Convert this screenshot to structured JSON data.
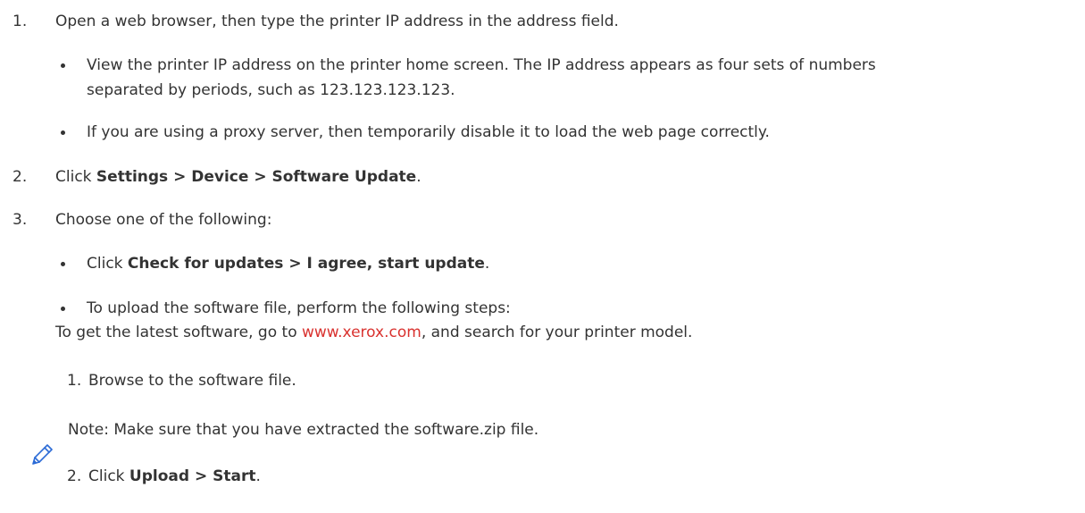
{
  "steps": [
    {
      "number": "1.",
      "text": "Open a web browser, then type the printer IP address in the address field.",
      "bullets": [
        {
          "line1": "View the printer IP address on the printer home screen. The IP address appears as four sets of numbers",
          "line2": "separated by periods, such as 123.123.123.123."
        },
        {
          "text": "If you are using a proxy server, then temporarily disable it to load the web page correctly."
        }
      ]
    },
    {
      "number": "2.",
      "pre": "Click ",
      "bold": "Settings > Device > Software Update",
      "post": "."
    },
    {
      "number": "3.",
      "text": "Choose one of the following:",
      "bullets": [
        {
          "pre": "Click ",
          "bold": "Check for updates > I agree, start update",
          "post": "."
        },
        {
          "text": "To upload the software file, perform the following steps:",
          "sub_pre": "To get the latest software, go to ",
          "link": "www.xerox.com",
          "sub_post": ", and search for your printer model."
        }
      ],
      "substeps": [
        {
          "number": "1.",
          "text": "Browse to the software file."
        },
        {
          "number": "2.",
          "pre": "Click ",
          "bold": "Upload > Start",
          "post": "."
        }
      ],
      "note": {
        "icon": "pencil-icon",
        "text": "Note: Make sure that you have extracted the software.zip file."
      }
    }
  ],
  "colors": {
    "text": "#333333",
    "link": "#d9322f",
    "icon": "#2c6bd6"
  }
}
